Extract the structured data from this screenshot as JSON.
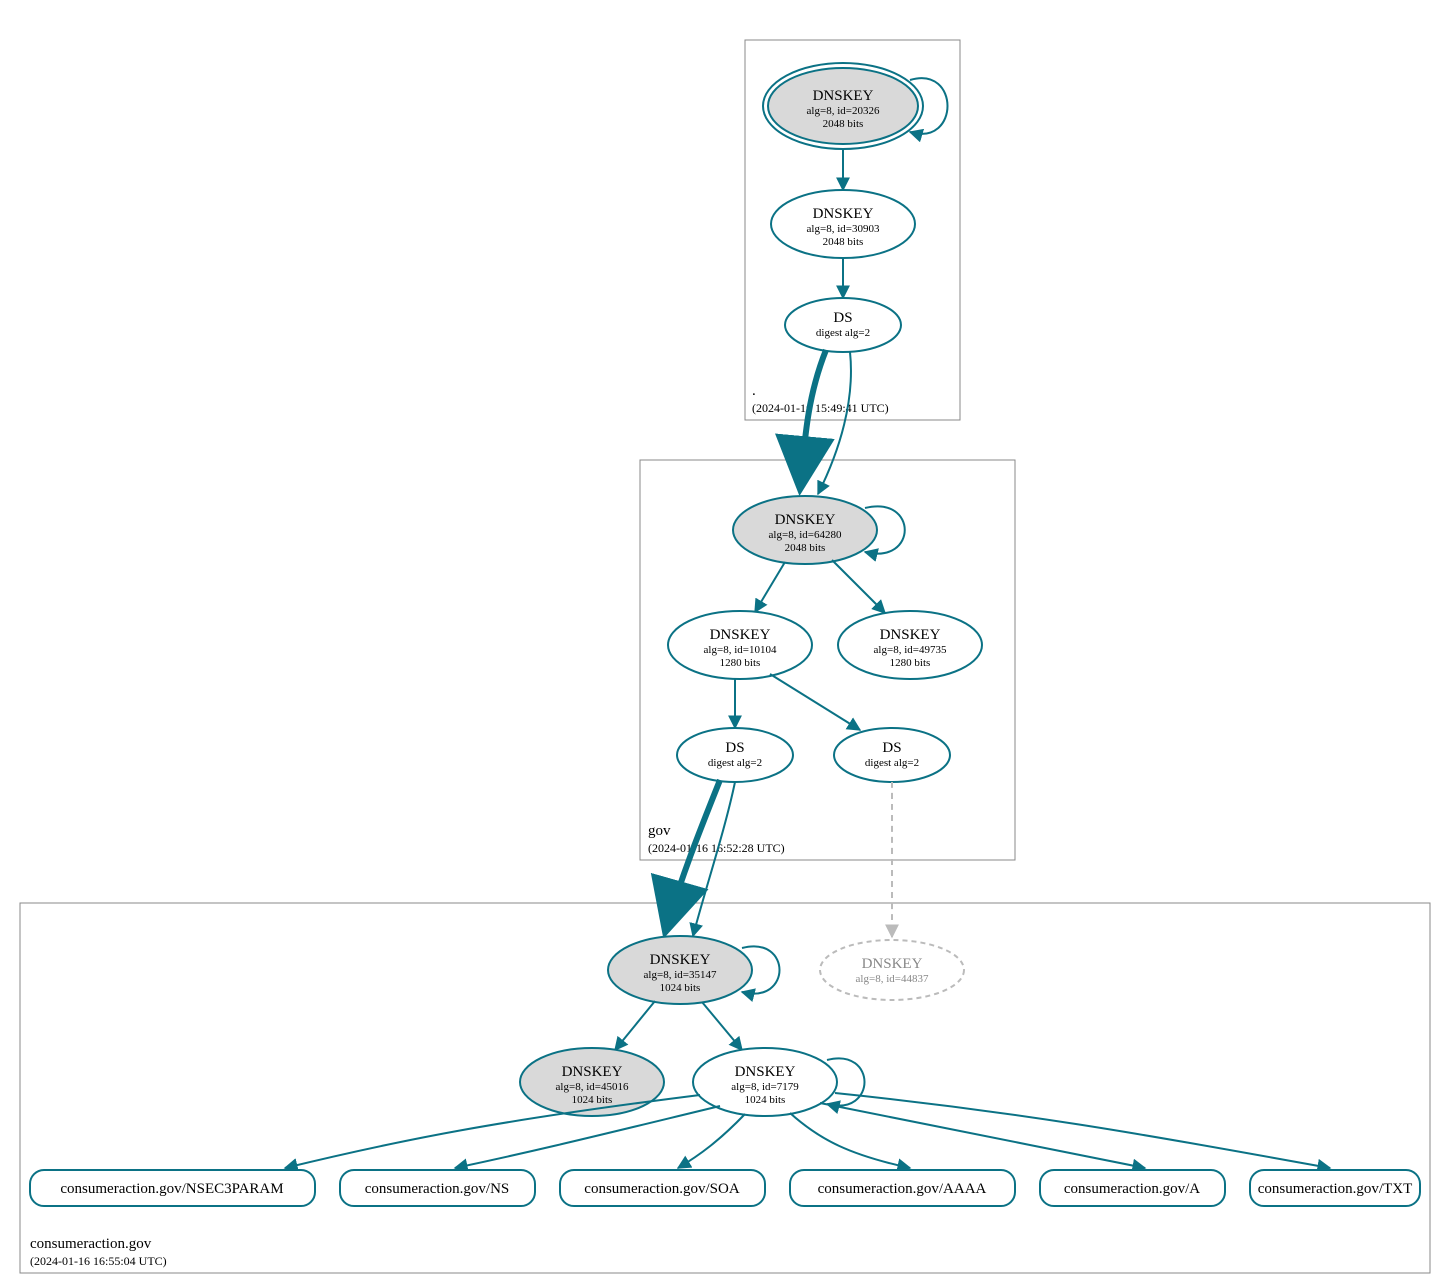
{
  "colors": {
    "border": "#888888",
    "stroke": "#0b7285",
    "greyFill": "#d9d9d9",
    "dashed": "#bbbbbb"
  },
  "zones": {
    "root": {
      "label": ".",
      "timestamp": "(2024-01-16 15:49:41 UTC)"
    },
    "gov": {
      "label": "gov",
      "timestamp": "(2024-01-16 16:52:28 UTC)"
    },
    "consumer": {
      "label": "consumeraction.gov",
      "timestamp": "(2024-01-16 16:55:04 UTC)"
    }
  },
  "nodes": {
    "root_ksk": {
      "title": "DNSKEY",
      "line1": "alg=8, id=20326",
      "line2": "2048 bits"
    },
    "root_zsk": {
      "title": "DNSKEY",
      "line1": "alg=8, id=30903",
      "line2": "2048 bits"
    },
    "root_ds": {
      "title": "DS",
      "line1": "digest alg=2"
    },
    "gov_ksk": {
      "title": "DNSKEY",
      "line1": "alg=8, id=64280",
      "line2": "2048 bits"
    },
    "gov_zsk1": {
      "title": "DNSKEY",
      "line1": "alg=8, id=10104",
      "line2": "1280 bits"
    },
    "gov_zsk2": {
      "title": "DNSKEY",
      "line1": "alg=8, id=49735",
      "line2": "1280 bits"
    },
    "gov_ds1": {
      "title": "DS",
      "line1": "digest alg=2"
    },
    "gov_ds2": {
      "title": "DS",
      "line1": "digest alg=2"
    },
    "con_ksk": {
      "title": "DNSKEY",
      "line1": "alg=8, id=35147",
      "line2": "1024 bits"
    },
    "con_missing": {
      "title": "DNSKEY",
      "line1": "alg=8, id=44837"
    },
    "con_zsk_alt": {
      "title": "DNSKEY",
      "line1": "alg=8, id=45016",
      "line2": "1024 bits"
    },
    "con_zsk": {
      "title": "DNSKEY",
      "line1": "alg=8, id=7179",
      "line2": "1024 bits"
    }
  },
  "rrsets": [
    "consumeraction.gov/NSEC3PARAM",
    "consumeraction.gov/NS",
    "consumeraction.gov/SOA",
    "consumeraction.gov/AAAA",
    "consumeraction.gov/A",
    "consumeraction.gov/TXT"
  ]
}
